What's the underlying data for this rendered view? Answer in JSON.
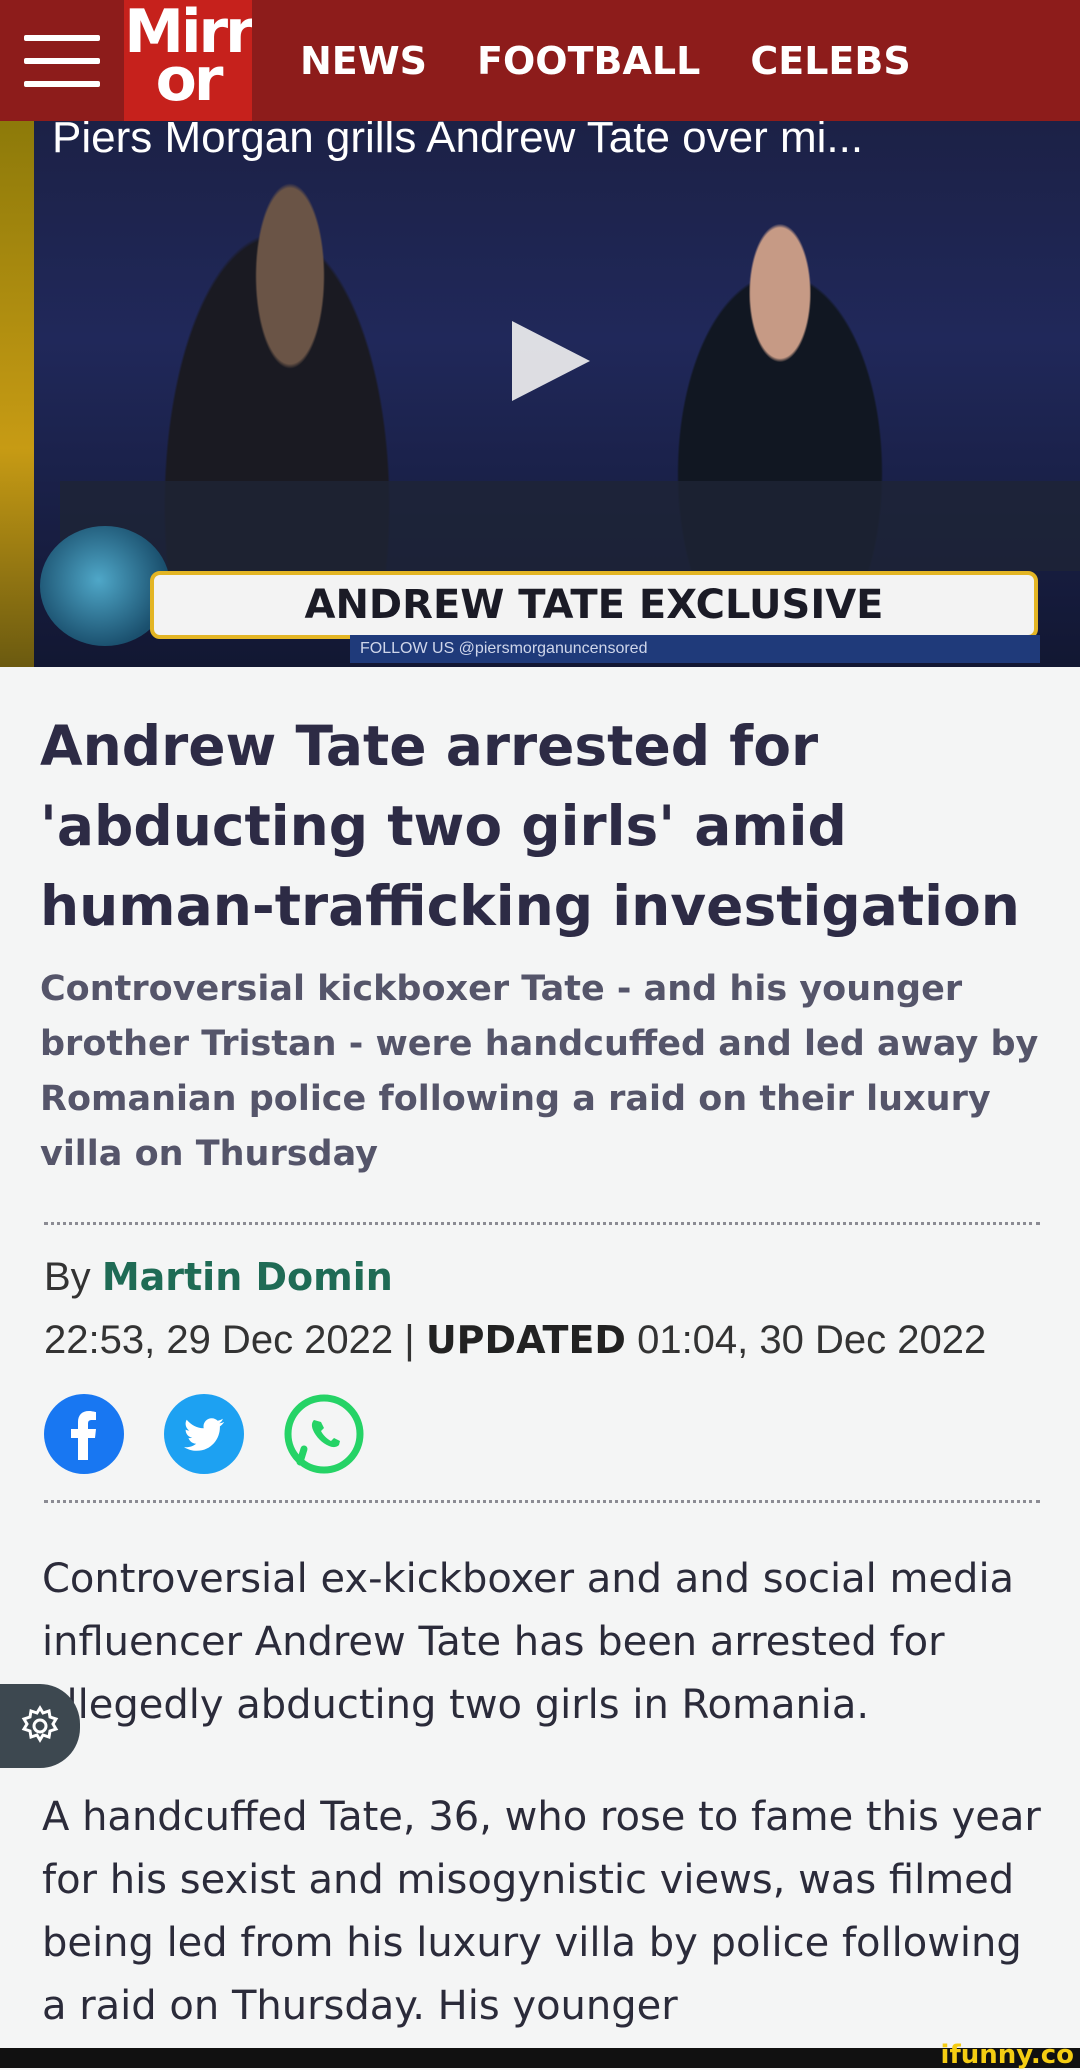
{
  "header": {
    "logo_line1": "Mirr",
    "logo_line2": "or",
    "nav": [
      "NEWS",
      "FOOTBALL",
      "CELEBS"
    ]
  },
  "video": {
    "title": "Piers Morgan grills Andrew Tate over mi...",
    "banner": "ANDREW TATE EXCLUSIVE",
    "follow": "FOLLOW US  @piersmorganuncensored"
  },
  "article": {
    "headline": "Andrew Tate arrested for 'abducting two girls' amid human-trafficking investigation",
    "standfirst": "Controversial kickboxer Tate - and his younger brother Tristan - were handcuffed and led away by Romanian police following a raid on their luxury villa on Thursday",
    "by_prefix": "By",
    "author": "Martin Domin",
    "published": "22:53, 29 Dec 2022",
    "separator": "|",
    "updated_label": "UPDATED",
    "updated": "01:04, 30 Dec 2022",
    "paragraphs": [
      "Controversial ex-kickboxer and and social media influencer Andrew Tate has been arrested for allegedly abducting two girls in Romania.",
      "A handcuffed Tate, 36, who rose to fame this year for his sexist and misogynistic views, was filmed being led from his luxury villa by police following a raid on Thursday. His younger"
    ]
  },
  "share": {
    "icons": [
      "facebook-icon",
      "twitter-icon",
      "whatsapp-icon"
    ],
    "colors": {
      "facebook": "#1877f2",
      "twitter": "#1da1f2",
      "whatsapp": "#25d366"
    }
  },
  "watermark": "ifunny.co",
  "colors": {
    "header_bg": "#8d1c1b",
    "logo_bg": "#c6211c",
    "author": "#1f6b55"
  }
}
